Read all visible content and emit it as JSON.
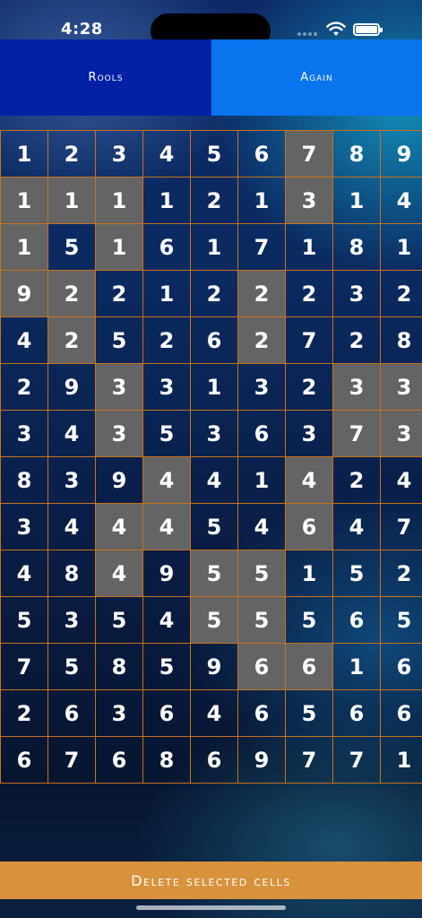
{
  "status_bar": {
    "time": "4:28",
    "icons": [
      "signal-icon",
      "wifi-icon",
      "battery-icon"
    ]
  },
  "buttons": {
    "rules_label": "Rools",
    "again_label": "Again",
    "delete_label": "Delete selected cells"
  },
  "colors": {
    "rules_bg": "#0321a4",
    "again_bg": "#0a74ee",
    "delete_bg": "#d8923c",
    "grid_line": "#c8711c",
    "selected_cell": "#646464"
  },
  "grid": {
    "rows": [
      [
        1,
        2,
        3,
        4,
        5,
        6,
        7,
        8,
        9
      ],
      [
        1,
        1,
        1,
        1,
        2,
        1,
        3,
        1,
        4
      ],
      [
        1,
        5,
        1,
        6,
        1,
        7,
        1,
        8,
        1
      ],
      [
        9,
        2,
        2,
        1,
        2,
        2,
        2,
        3,
        2
      ],
      [
        4,
        2,
        5,
        2,
        6,
        2,
        7,
        2,
        8
      ],
      [
        2,
        9,
        3,
        3,
        1,
        3,
        2,
        3,
        3
      ],
      [
        3,
        4,
        3,
        5,
        3,
        6,
        3,
        7,
        3
      ],
      [
        8,
        3,
        9,
        4,
        4,
        1,
        4,
        2,
        4
      ],
      [
        3,
        4,
        4,
        4,
        5,
        4,
        6,
        4,
        7
      ],
      [
        4,
        8,
        4,
        9,
        5,
        5,
        1,
        5,
        2
      ],
      [
        5,
        3,
        5,
        4,
        5,
        5,
        5,
        6,
        5
      ],
      [
        7,
        5,
        8,
        5,
        9,
        6,
        6,
        1,
        6
      ],
      [
        2,
        6,
        3,
        6,
        4,
        6,
        5,
        6,
        6
      ],
      [
        6,
        7,
        6,
        8,
        6,
        9,
        7,
        7,
        1
      ]
    ],
    "selected": [
      [
        0,
        6
      ],
      [
        1,
        0
      ],
      [
        1,
        1
      ],
      [
        1,
        2
      ],
      [
        1,
        6
      ],
      [
        2,
        0
      ],
      [
        2,
        2
      ],
      [
        3,
        0
      ],
      [
        3,
        1
      ],
      [
        3,
        5
      ],
      [
        4,
        1
      ],
      [
        4,
        5
      ],
      [
        5,
        2
      ],
      [
        5,
        7
      ],
      [
        5,
        8
      ],
      [
        6,
        2
      ],
      [
        6,
        7
      ],
      [
        6,
        8
      ],
      [
        7,
        3
      ],
      [
        7,
        6
      ],
      [
        8,
        2
      ],
      [
        8,
        3
      ],
      [
        8,
        6
      ],
      [
        9,
        2
      ],
      [
        9,
        4
      ],
      [
        9,
        5
      ],
      [
        10,
        4
      ],
      [
        10,
        5
      ],
      [
        11,
        5
      ],
      [
        11,
        6
      ]
    ]
  }
}
